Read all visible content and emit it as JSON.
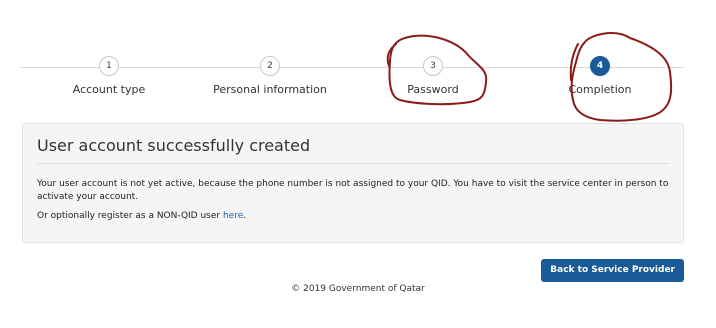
{
  "stepper": {
    "steps": [
      {
        "number": "1",
        "label": "Account type"
      },
      {
        "number": "2",
        "label": "Personal information"
      },
      {
        "number": "3",
        "label": "Password"
      },
      {
        "number": "4",
        "label": "Completion"
      }
    ],
    "active_step": 4
  },
  "panel": {
    "title": "User account successfully created",
    "message": "Your user account is not yet active, because the phone number is not assigned to your QID. You have to visit the service center in person to activate your account.",
    "alt_prefix": "Or optionally register as a NON-QID user ",
    "alt_link": "here",
    "alt_suffix": "."
  },
  "actions": {
    "back_label": "Back to Service Provider"
  },
  "footer": {
    "copyright": "© 2019 Government of Qatar"
  },
  "colors": {
    "accent": "#1a5a96",
    "link": "#1c66ad",
    "annotation": "#8b1a1a"
  }
}
